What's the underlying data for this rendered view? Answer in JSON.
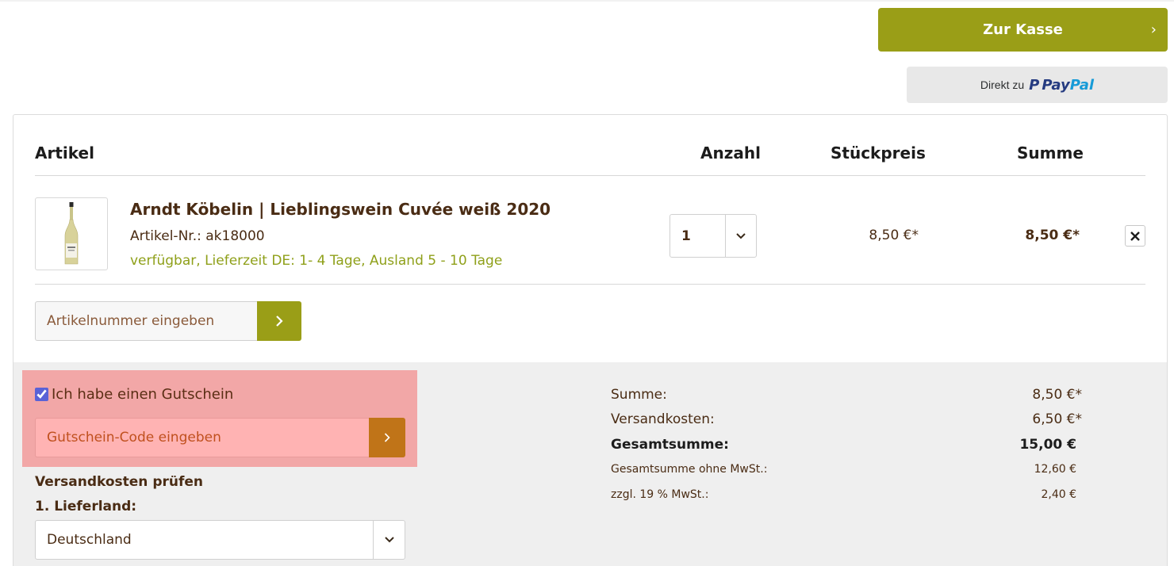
{
  "header": {
    "checkout_label": "Zur Kasse",
    "paypal_prefix": "Direkt zu",
    "paypal_brand_pay": "Pay",
    "paypal_brand_pal": "Pal"
  },
  "table": {
    "headers": {
      "article": "Artikel",
      "quantity": "Anzahl",
      "unit_price": "Stückpreis",
      "total": "Summe"
    }
  },
  "item": {
    "name": "Arndt Köbelin | Lieblingswein Cuvée weiß 2020",
    "sku": "Artikel-Nr.: ak18000",
    "availability": "verfügbar, Lieferzeit DE: 1- 4 Tage, Ausland 5 - 10 Tage",
    "quantity": "1",
    "unit_price": "8,50 €*",
    "line_total": "8,50 €*"
  },
  "article_input": {
    "placeholder": "Artikelnummer eingeben"
  },
  "voucher": {
    "checkbox_label": "Ich habe einen Gutschein",
    "checked": true,
    "placeholder": "Gutschein-Code eingeben"
  },
  "shipping": {
    "title": "Versandkosten prüfen",
    "country_label": "1. Lieferland:",
    "country_value": "Deutschland"
  },
  "summary": {
    "subtotal_label": "Summe:",
    "subtotal_value": "8,50 €*",
    "shipping_label": "Versandkosten:",
    "shipping_value": "6,50 €*",
    "grand_total_label": "Gesamtsumme:",
    "grand_total_value": "15,00 €",
    "net_label": "Gesamtsumme ohne MwSt.:",
    "net_value": "12,60 €",
    "vat_label": "zzgl. 19 % MwSt.:",
    "vat_value": "2,40 €"
  },
  "colors": {
    "accent_olive": "#9a9e17",
    "voucher_highlight": "#f2a7a7",
    "voucher_button": "#c07418",
    "availability_green": "#8fa01a",
    "text_brown": "#4a2c14"
  }
}
